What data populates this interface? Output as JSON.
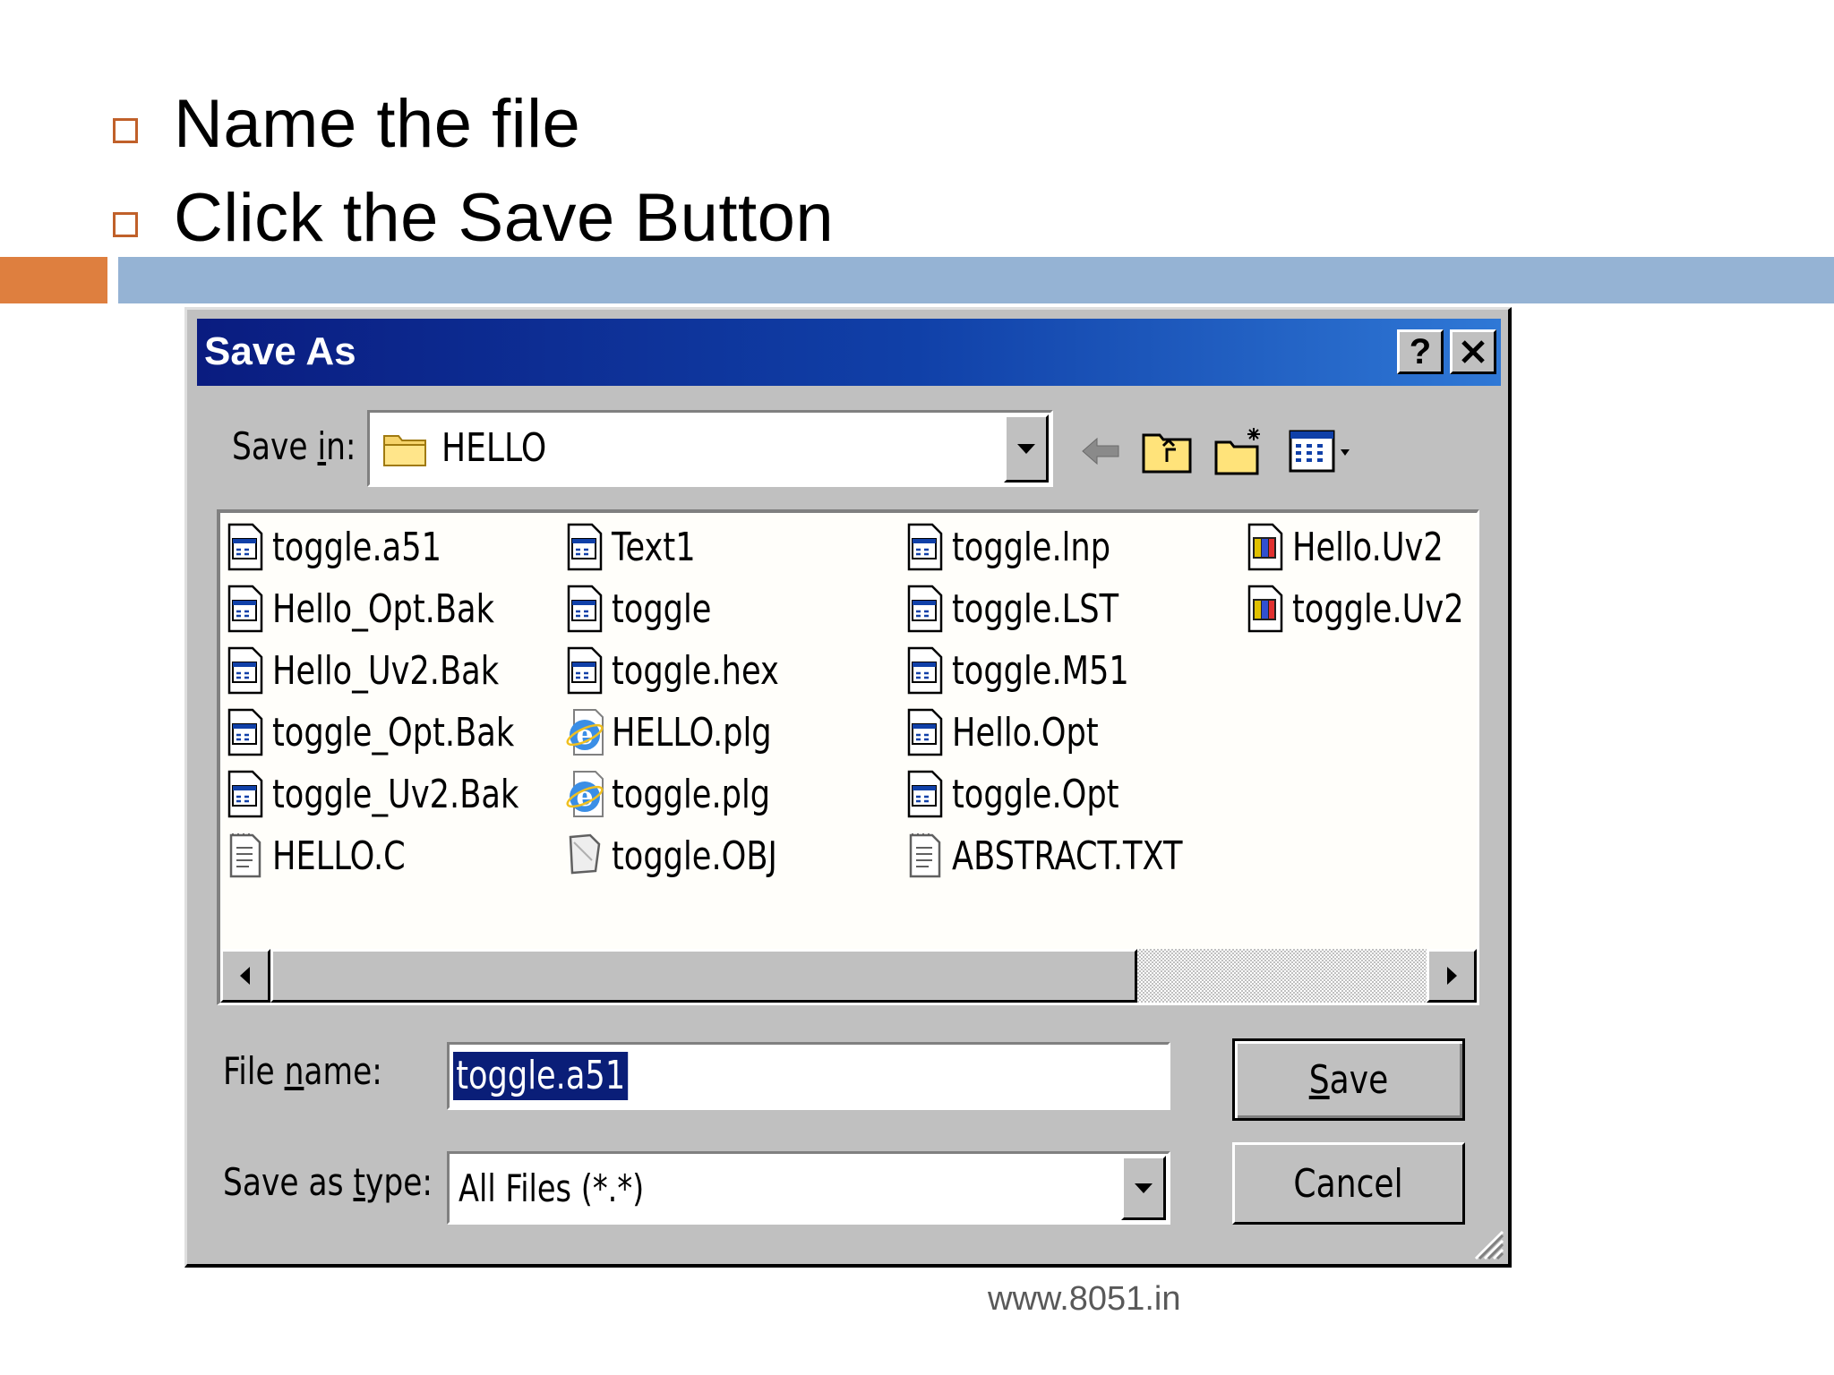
{
  "slide": {
    "bullets": [
      "Name the file",
      "Click the Save Button"
    ],
    "footer": "www.8051.in",
    "colors": {
      "accent_orange": "#de7f3f",
      "accent_blue": "#95b3d4",
      "bullet_box": "#c0602a"
    }
  },
  "dialog": {
    "title": "Save As",
    "help_label": "?",
    "close_label": "✕",
    "save_in": {
      "label_pre": "Save ",
      "label_ul": "i",
      "label_post": "n:",
      "value": "HELLO",
      "icon": "folder-icon"
    },
    "toolbar": [
      "back-icon",
      "up-folder-icon",
      "new-folder-icon",
      "view-menu-icon"
    ],
    "files": [
      [
        {
          "name": "toggle.a51",
          "icon": "document-icon"
        },
        {
          "name": "Hello_Opt.Bak",
          "icon": "document-icon"
        },
        {
          "name": "Hello_Uv2.Bak",
          "icon": "document-icon"
        },
        {
          "name": "toggle_Opt.Bak",
          "icon": "document-icon"
        },
        {
          "name": "toggle_Uv2.Bak",
          "icon": "document-icon"
        },
        {
          "name": "HELLO.C",
          "icon": "text-file-icon"
        }
      ],
      [
        {
          "name": "Text1",
          "icon": "document-icon"
        },
        {
          "name": "toggle",
          "icon": "document-icon"
        },
        {
          "name": "toggle.hex",
          "icon": "document-icon"
        },
        {
          "name": "HELLO.plg",
          "icon": "ie-icon"
        },
        {
          "name": "toggle.plg",
          "icon": "ie-icon"
        },
        {
          "name": "toggle.OBJ",
          "icon": "generic-file-icon"
        }
      ],
      [
        {
          "name": "toggle.lnp",
          "icon": "document-icon"
        },
        {
          "name": "toggle.LST",
          "icon": "document-icon"
        },
        {
          "name": "toggle.M51",
          "icon": "document-icon"
        },
        {
          "name": "Hello.Opt",
          "icon": "document-icon"
        },
        {
          "name": "toggle.Opt",
          "icon": "document-icon"
        },
        {
          "name": "ABSTRACT.TXT",
          "icon": "text-file-icon"
        }
      ],
      [
        {
          "name": "Hello.Uv2",
          "icon": "uvision-project-icon"
        },
        {
          "name": "toggle.Uv2",
          "icon": "uvision-project-icon"
        }
      ]
    ],
    "file_name": {
      "label_pre": "File ",
      "label_ul": "n",
      "label_post": "ame:",
      "value": "toggle.a51"
    },
    "save_as_type": {
      "label_pre": "Save as ",
      "label_ul": "t",
      "label_post": "ype:",
      "value": "All Files (*.*)"
    },
    "save_button": {
      "label_ul": "S",
      "label_post": "ave"
    },
    "cancel_button": "Cancel",
    "colors": {
      "titlebar_start": "#0a1c80",
      "titlebar_end": "#2f78d6",
      "face": "#c0c0c0",
      "selection": "#0a1e78"
    }
  }
}
